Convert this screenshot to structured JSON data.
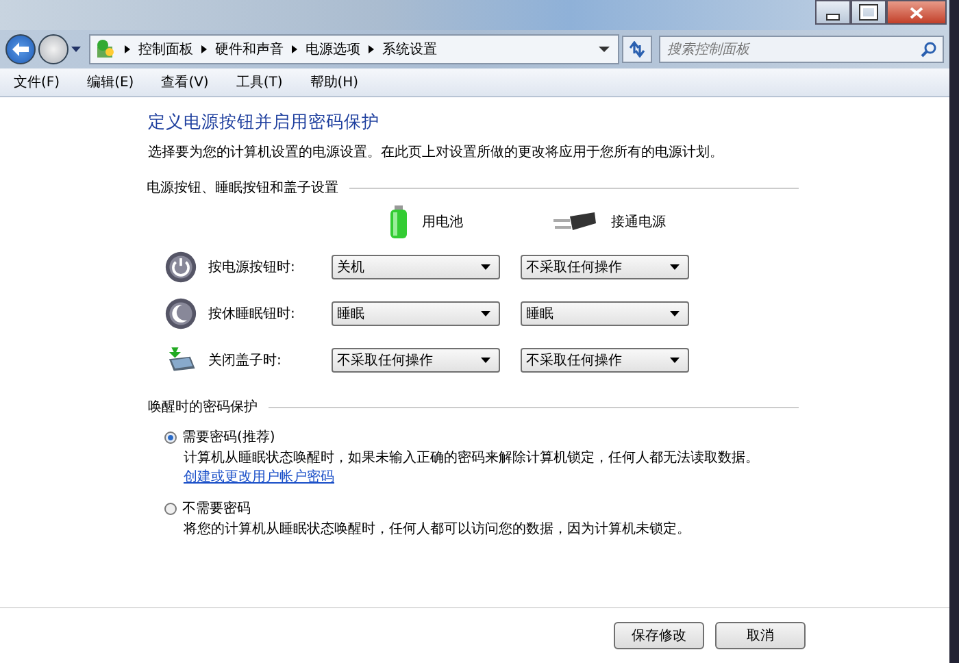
{
  "address_bar": {
    "crumbs": [
      "控制面板",
      "硬件和声音",
      "电源选项",
      "系统设置"
    ],
    "search_placeholder": "搜索控制面板"
  },
  "menu": [
    "文件(F)",
    "编辑(E)",
    "查看(V)",
    "工具(T)",
    "帮助(H)"
  ],
  "page": {
    "title": "定义电源按钮并启用密码保护",
    "intro": "选择要为您的计算机设置的电源设置。在此页上对设置所做的更改将应用于您所有的电源计划。"
  },
  "power_section": {
    "heading": "电源按钮、睡眠按钮和盖子设置",
    "columns": [
      "用电池",
      "接通电源"
    ],
    "rows": [
      {
        "kind": "power",
        "label": "按电源按钮时:",
        "battery": "关机",
        "plugged": "不采取任何操作"
      },
      {
        "kind": "sleep",
        "label": "按休睡眠钮时:",
        "battery": "睡眠",
        "plugged": "睡眠"
      },
      {
        "kind": "lid",
        "label": "关闭盖子时:",
        "battery": "不采取任何操作",
        "plugged": "不采取任何操作"
      }
    ]
  },
  "password_section": {
    "heading": "唤醒时的密码保护",
    "options": [
      {
        "label": "需要密码(推荐)",
        "selected": true,
        "description": "计算机从睡眠状态唤醒时，如果未输入正确的密码来解除计算机锁定，任何人都无法读取数据。",
        "link": "创建或更改用户帐户密码"
      },
      {
        "label": "不需要密码",
        "selected": false,
        "description": "将您的计算机从睡眠状态唤醒时，任何人都可以访问您的数据，因为计算机未锁定。"
      }
    ]
  },
  "buttons": [
    "保存修改",
    "取消"
  ]
}
